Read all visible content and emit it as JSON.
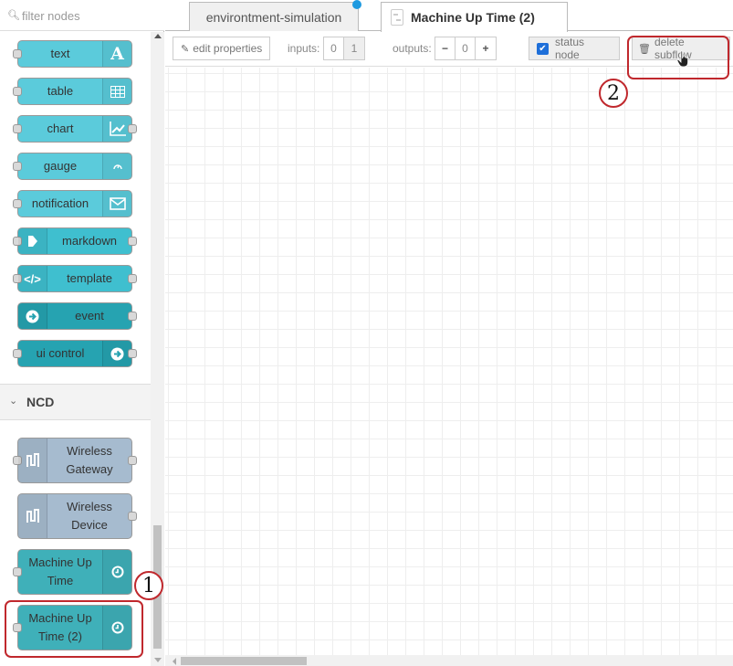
{
  "palette": {
    "filter_placeholder": "filter nodes",
    "dashboard_nodes": [
      {
        "label": "text",
        "icon": "text-A-icon"
      },
      {
        "label": "table",
        "icon": "table-icon"
      },
      {
        "label": "chart",
        "icon": "chart-icon"
      },
      {
        "label": "gauge",
        "icon": "gauge-icon"
      },
      {
        "label": "notification",
        "icon": "envelope-icon"
      },
      {
        "label": "markdown",
        "icon": "arrow-right-icon"
      },
      {
        "label": "template",
        "icon": "code-icon"
      },
      {
        "label": "event",
        "icon": "arrow-circle-right-icon"
      },
      {
        "label": "ui control",
        "icon": "arrow-circle-right-icon"
      }
    ],
    "category": {
      "name": "NCD",
      "expanded": true
    },
    "ncd_nodes": [
      {
        "label": "Wireless Gateway",
        "icon": "pulse-wave-icon"
      },
      {
        "label": "Wireless Device",
        "icon": "pulse-wave-icon"
      },
      {
        "label": "Machine Up Time",
        "icon": "clock-icon"
      },
      {
        "label": "Machine Up Time (2)",
        "icon": "clock-icon"
      }
    ]
  },
  "tabs": [
    {
      "label": "environtment-simulation",
      "active": false,
      "changed": true
    },
    {
      "label": "Machine Up Time (2)",
      "active": true,
      "icon": "subflow-icon"
    }
  ],
  "subflow_toolbar": {
    "edit_properties_label": "edit properties",
    "inputs_label": "inputs:",
    "inputs_options": [
      "0",
      "1"
    ],
    "inputs_selected": "1",
    "outputs_label": "outputs:",
    "outputs_minus": "−",
    "outputs_value": "0",
    "outputs_plus": "+",
    "status_node_label": "status node",
    "status_node_checked": true,
    "delete_subflow_label": "delete subflow"
  },
  "annotations": [
    {
      "number": "1",
      "target": "Machine Up Time (2) palette node"
    },
    {
      "number": "2",
      "target": "delete subflow button"
    }
  ],
  "colors": {
    "annotation": "#c0282d",
    "dashboard_light": "#5bcbdb",
    "dashboard_dark": "#26a3b1",
    "ncd_node": "#a6bbcf",
    "checkbox": "#1e6fd9",
    "changed_dot": "#1e9ae0"
  }
}
